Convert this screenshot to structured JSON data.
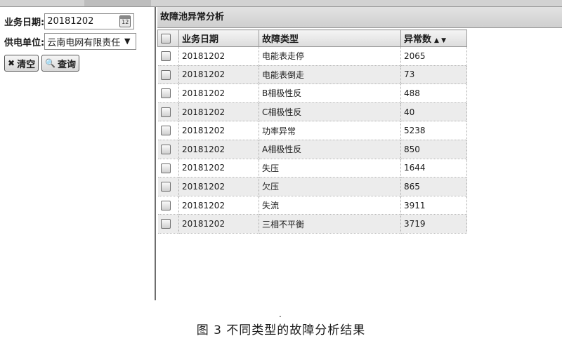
{
  "form": {
    "date_label": "业务日期:",
    "date_value": "20181202",
    "unit_label": "供电单位:",
    "unit_value": "云南电网有限责任",
    "clear_label": "清空",
    "query_label": "查询"
  },
  "panel": {
    "title": "故障池异常分析"
  },
  "table": {
    "headers": [
      "业务日期",
      "故障类型",
      "异常数"
    ],
    "rows": [
      [
        "20181202",
        "电能表走停",
        "2065"
      ],
      [
        "20181202",
        "电能表倒走",
        "73"
      ],
      [
        "20181202",
        "B相极性反",
        "488"
      ],
      [
        "20181202",
        "C相极性反",
        "40"
      ],
      [
        "20181202",
        "功率异常",
        "5238"
      ],
      [
        "20181202",
        "A相极性反",
        "850"
      ],
      [
        "20181202",
        "失压",
        "1644"
      ],
      [
        "20181202",
        "欠压",
        "865"
      ],
      [
        "20181202",
        "失流",
        "3911"
      ],
      [
        "20181202",
        "三相不平衡",
        "3719"
      ]
    ]
  },
  "caption": {
    "dot": ".",
    "text": "图 3  不同类型的故障分析结果"
  }
}
